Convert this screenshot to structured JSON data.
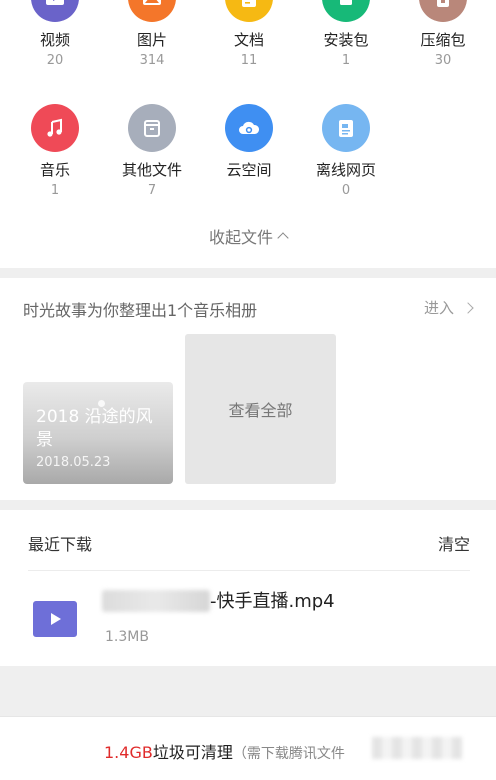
{
  "categories": [
    {
      "label": "视频",
      "count": "20",
      "icon": "video-icon",
      "color": "#6a63c9"
    },
    {
      "label": "图片",
      "count": "314",
      "icon": "image-icon",
      "color": "#f4762a"
    },
    {
      "label": "文档",
      "count": "11",
      "icon": "document-icon",
      "color": "#f6b913"
    },
    {
      "label": "安装包",
      "count": "1",
      "icon": "android-icon",
      "color": "#17b978"
    },
    {
      "label": "压缩包",
      "count": "30",
      "icon": "archive-icon",
      "color": "#b9877a"
    },
    {
      "label": "音乐",
      "count": "1",
      "icon": "music-icon",
      "color": "#ef4a57"
    },
    {
      "label": "其他文件",
      "count": "7",
      "icon": "box-icon",
      "color": "#a7aebb"
    },
    {
      "label": "云空间",
      "count": "",
      "icon": "cloud-icon",
      "color": "#3f8ff2"
    },
    {
      "label": "离线网页",
      "count": "0",
      "icon": "webpage-icon",
      "color": "#76b6f1"
    }
  ],
  "collapse_label": "收起文件",
  "story": {
    "title": "时光故事为你整理出1个音乐相册",
    "enter_label": "进入",
    "album_title": "2018 沿途的风景",
    "album_date": "2018.05.23",
    "view_all_label": "查看全部"
  },
  "recent": {
    "title": "最近下载",
    "clear_label": "清空",
    "file_name": "-快手直播.mp4",
    "file_size": "1.3MB"
  },
  "bottom": {
    "size": "1.4GB",
    "text": "垃圾可清理",
    "note": "（需下载腾讯文件"
  }
}
